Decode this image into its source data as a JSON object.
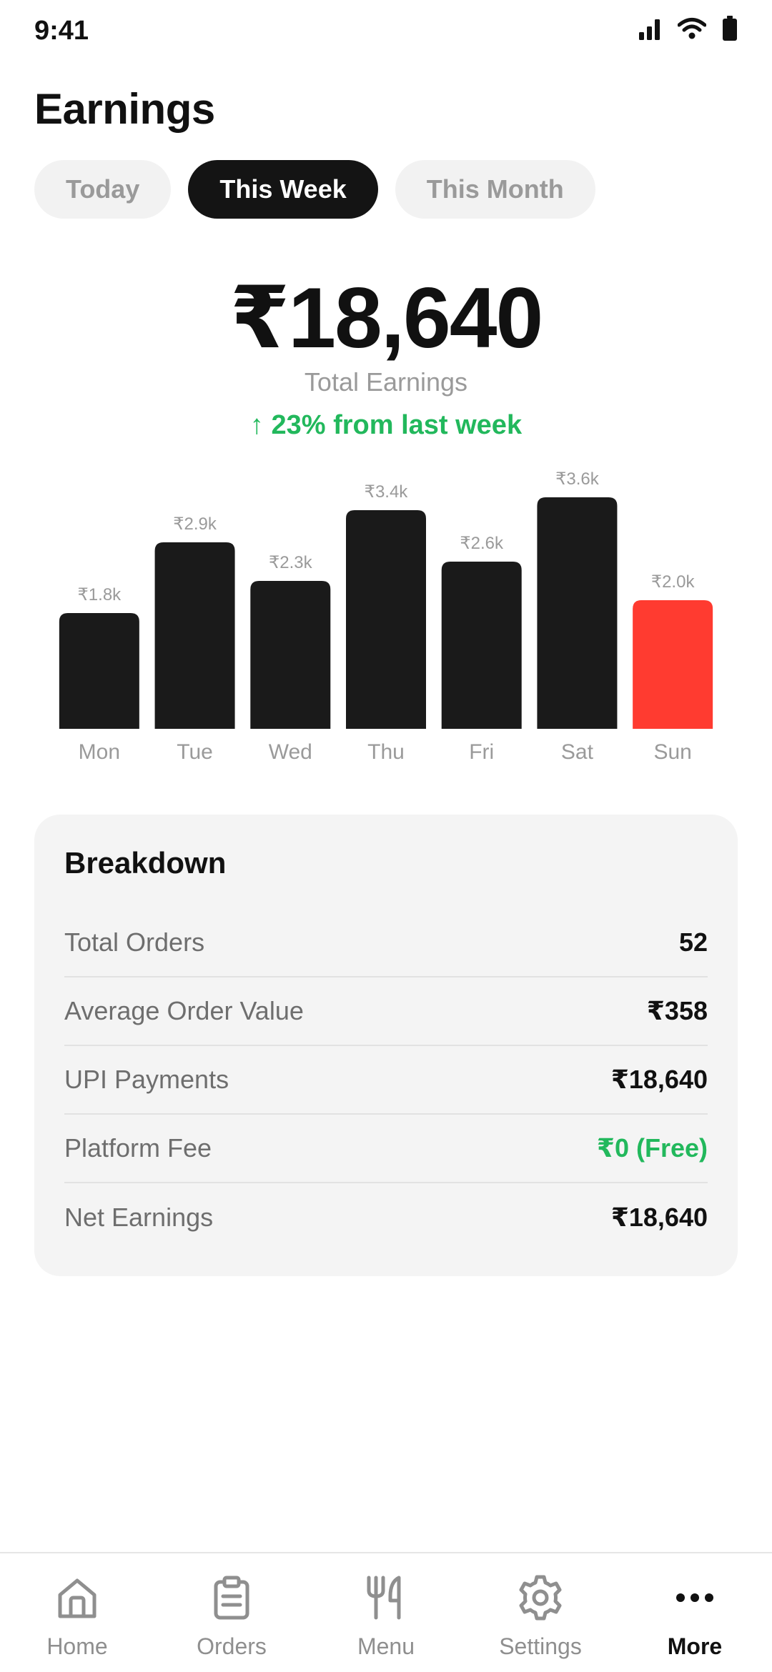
{
  "status_bar": {
    "time": "9:41",
    "icons": [
      "signal-icon",
      "wifi-icon",
      "battery-icon"
    ]
  },
  "header": {
    "title": "Earnings"
  },
  "tabs": [
    {
      "label": "Today",
      "active": false
    },
    {
      "label": "This Week",
      "active": true
    },
    {
      "label": "This Month",
      "active": false
    }
  ],
  "summary": {
    "amount": "₹18,640",
    "label": "Total Earnings",
    "change": "↑ 23% from last week"
  },
  "colors": {
    "bar": "#1a1a1a",
    "highlight": "#ff3b30",
    "positive": "#22b85c",
    "muted": "#9a9a9a"
  },
  "chart_data": {
    "type": "bar",
    "categories": [
      "Mon",
      "Tue",
      "Wed",
      "Thu",
      "Fri",
      "Sat",
      "Sun"
    ],
    "values": [
      1.8,
      2.9,
      2.3,
      3.4,
      2.6,
      3.6,
      2.0
    ],
    "value_labels": [
      "₹1.8k",
      "₹2.9k",
      "₹2.3k",
      "₹3.4k",
      "₹2.6k",
      "₹3.6k",
      "₹2.0k"
    ],
    "highlight_index": 6,
    "ylim": [
      0,
      3.6
    ],
    "grid": false
  },
  "breakdown": {
    "title": "Breakdown",
    "rows": [
      {
        "label": "Total Orders",
        "value": "52",
        "highlight": false
      },
      {
        "label": "Average Order Value",
        "value": "₹358",
        "highlight": false
      },
      {
        "label": "UPI Payments",
        "value": "₹18,640",
        "highlight": false
      },
      {
        "label": "Platform Fee",
        "value": "₹0 (Free)",
        "highlight": true
      },
      {
        "label": "Net Earnings",
        "value": "₹18,640",
        "highlight": false
      }
    ]
  },
  "nav": {
    "items": [
      {
        "label": "Home",
        "icon": "home-icon",
        "active": false
      },
      {
        "label": "Orders",
        "icon": "clipboard-icon",
        "active": false
      },
      {
        "label": "Menu",
        "icon": "fork-knife-icon",
        "active": false
      },
      {
        "label": "Settings",
        "icon": "gear-icon",
        "active": false
      },
      {
        "label": "More",
        "icon": "more-dots-icon",
        "active": true
      }
    ]
  }
}
